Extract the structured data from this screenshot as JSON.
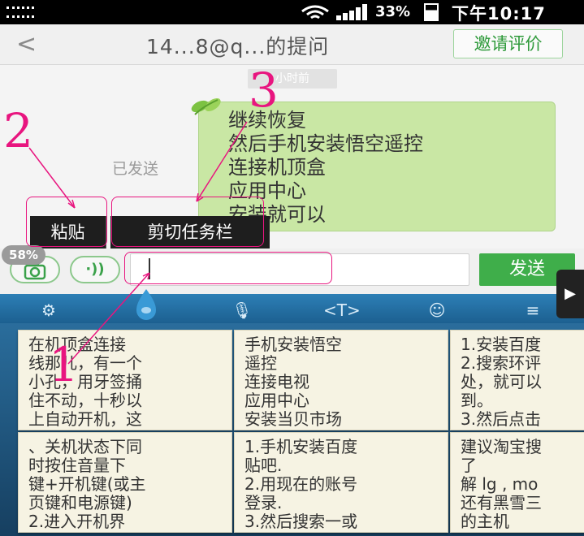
{
  "status_bar": {
    "battery_text": "33%",
    "time": "下午10:17",
    "wifi_icon": "wifi-icon",
    "signal_icon": "signal-icon",
    "battery_icon": "battery-icon",
    "menu_icon": "grid-icon"
  },
  "header": {
    "back_label": "<",
    "title": "14...8@q...的提问",
    "invite_label": "邀请评价"
  },
  "chat": {
    "time_tag": "小时前",
    "sent_label": "已发送",
    "message_lines": [
      "继续恢复",
      "然后手机安装悟空遥控",
      "连接机顶盒",
      "应用中心",
      "安装就可以"
    ]
  },
  "context_menu": {
    "paste_label": "粘贴",
    "cut_taskbar_label": "剪切任务栏"
  },
  "input_row": {
    "percent_badge": "58%",
    "send_label": "发送",
    "input_value": "",
    "camera_icon": "camera-icon",
    "voice_icon": "voice-icon"
  },
  "keyboard_bar": {
    "icons": [
      "settings-icon",
      "location-icon",
      "microphone-icon",
      "text-cursor-icon",
      "emoji-icon",
      "menu-icon"
    ],
    "cursor_glyph": "<T>"
  },
  "suggestions": [
    {
      "lines": [
        "在机顶盒连接",
        "线那儿，有一个",
        "小孔，用牙签捅",
        "住不动，十秒以",
        "上自动开机，这"
      ]
    },
    {
      "lines": [
        "手机安装悟空",
        "遥控",
        "连接电视",
        "应用中心",
        "安装当贝市场"
      ]
    },
    {
      "lines": [
        "1.安装百度",
        "2.搜索环评",
        "处，就可以",
        "到。",
        "3.然后点击"
      ]
    },
    {
      "lines": [
        "、关机状态下同",
        "时按住音量下",
        "键+开机键(或主",
        "页键和电源键)",
        "2.进入开机界"
      ]
    },
    {
      "lines": [
        "1.手机安装百度",
        "贴吧.",
        "2.用现在的账号",
        "登录.",
        "3.然后搜索一或"
      ]
    },
    {
      "lines": [
        "建议淘宝搜",
        "了",
        "解 lg , mo",
        "还有黑雪三",
        "的主机"
      ]
    }
  ],
  "annotations": [
    "1",
    "2",
    "3"
  ],
  "colors": {
    "bubble": "#c9e7a4",
    "send": "#3fae4a",
    "annotation": "#e8157f",
    "keyboard": "#2a6d9c"
  }
}
